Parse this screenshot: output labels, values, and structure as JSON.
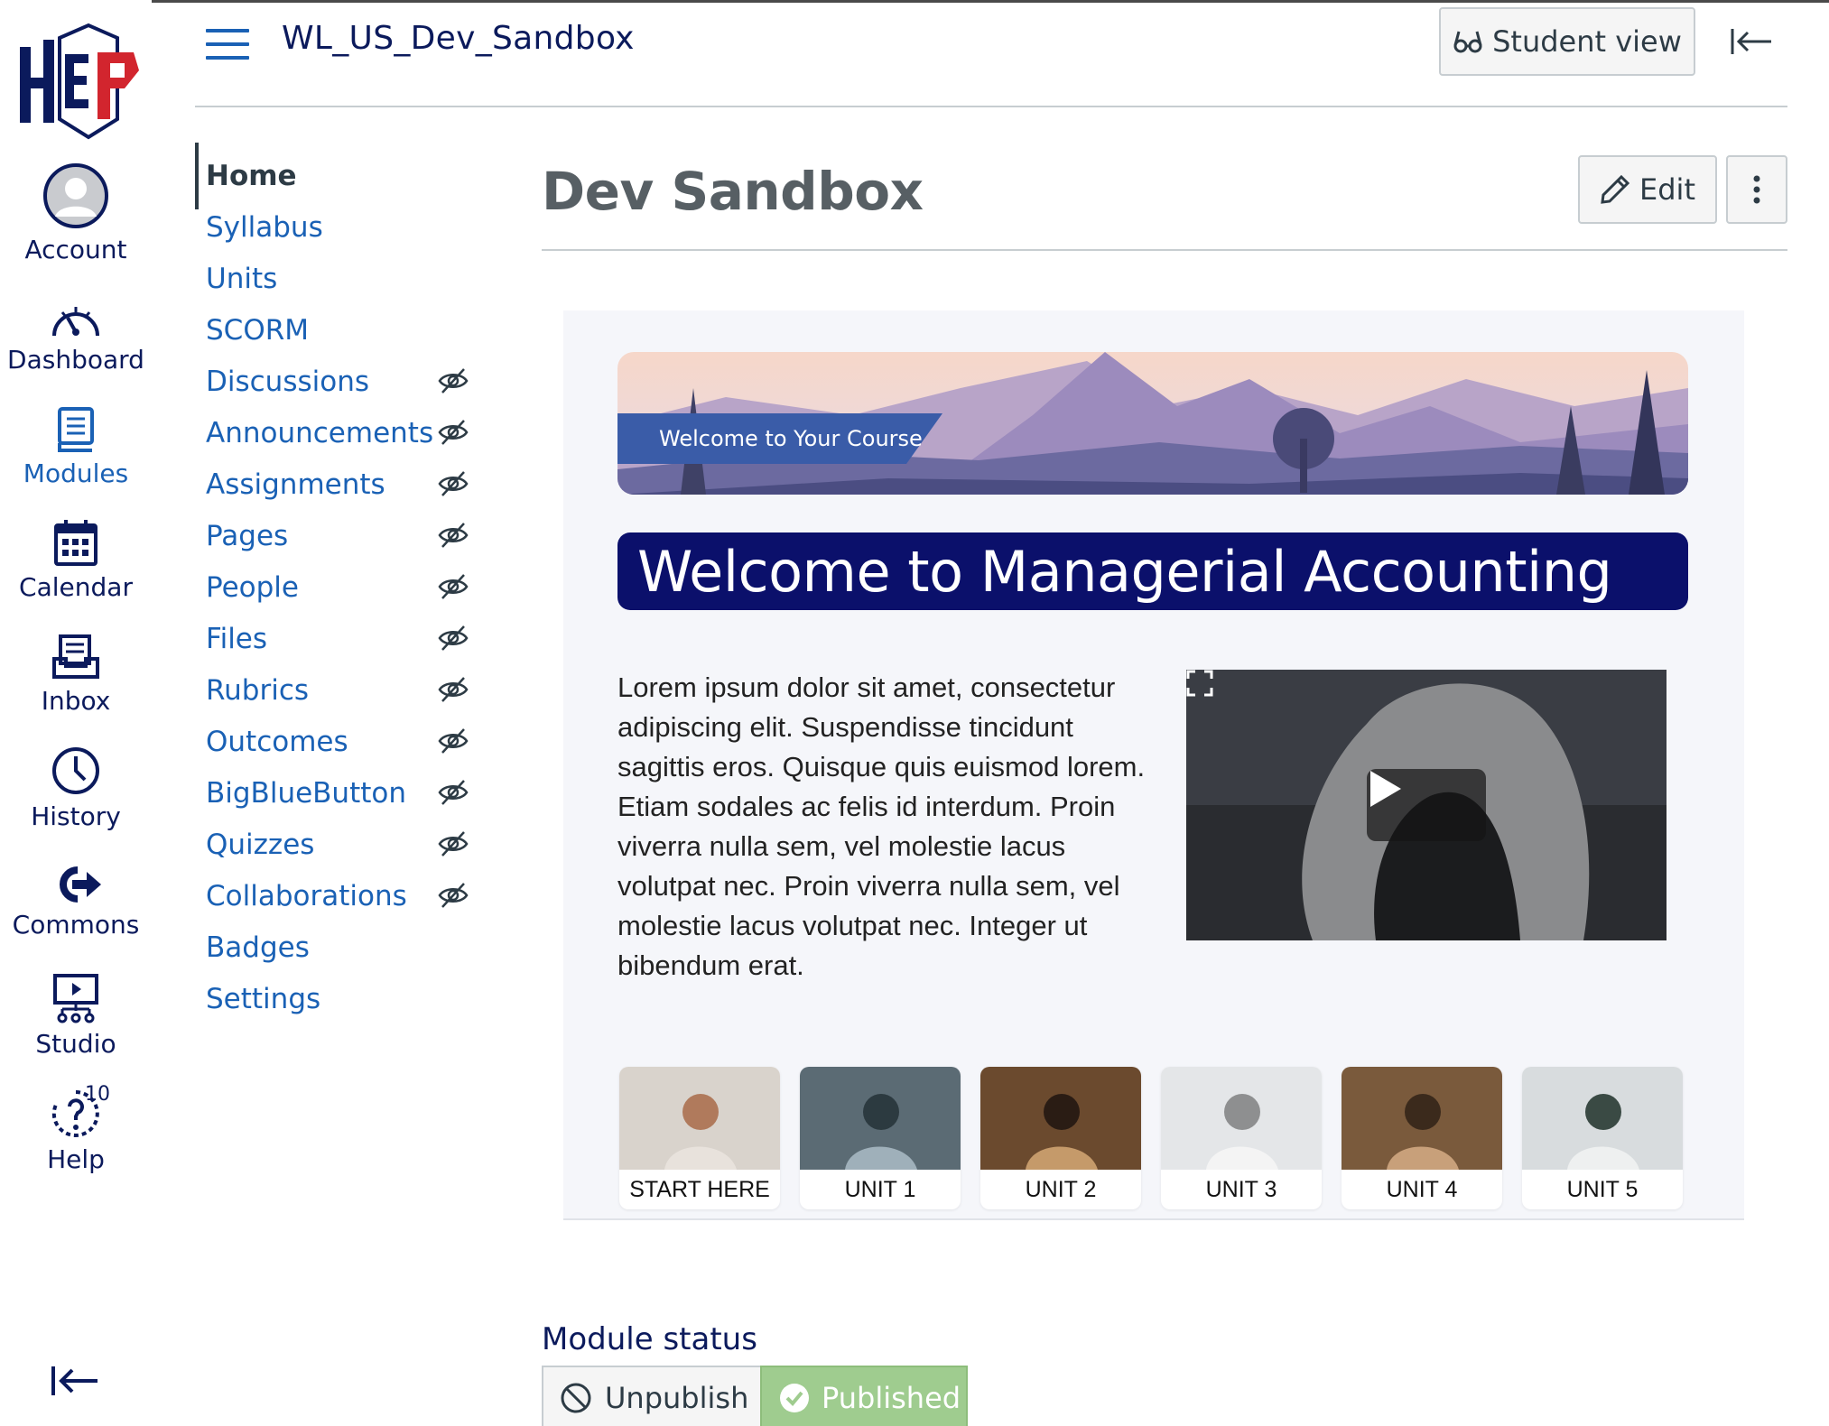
{
  "colors": {
    "accent": "#1a61b5",
    "navy": "#0b1a5c",
    "welcome_bar": "#0b106b",
    "published": "#9fcc8f"
  },
  "global_nav": {
    "logo_text": "HEP",
    "items": [
      {
        "label": "Account",
        "icon": "avatar-icon"
      },
      {
        "label": "Dashboard",
        "icon": "dashboard-icon"
      },
      {
        "label": "Modules",
        "icon": "modules-icon"
      },
      {
        "label": "Calendar",
        "icon": "calendar-icon"
      },
      {
        "label": "Inbox",
        "icon": "inbox-icon"
      },
      {
        "label": "History",
        "icon": "clock-icon"
      },
      {
        "label": "Commons",
        "icon": "commons-icon"
      },
      {
        "label": "Studio",
        "icon": "studio-icon"
      },
      {
        "label": "Help",
        "icon": "help-icon",
        "badge": "10"
      }
    ]
  },
  "header": {
    "course_name": "WL_US_Dev_Sandbox",
    "student_view_label": "Student view"
  },
  "course_nav": [
    {
      "label": "Home",
      "hidden": false
    },
    {
      "label": "Syllabus",
      "hidden": false
    },
    {
      "label": "Units",
      "hidden": false
    },
    {
      "label": "SCORM",
      "hidden": false
    },
    {
      "label": "Discussions",
      "hidden": true
    },
    {
      "label": "Announcements",
      "hidden": true
    },
    {
      "label": "Assignments",
      "hidden": true
    },
    {
      "label": "Pages",
      "hidden": true
    },
    {
      "label": "People",
      "hidden": true
    },
    {
      "label": "Files",
      "hidden": true
    },
    {
      "label": "Rubrics",
      "hidden": true
    },
    {
      "label": "Outcomes",
      "hidden": true
    },
    {
      "label": "BigBlueButton",
      "hidden": true
    },
    {
      "label": "Quizzes",
      "hidden": true
    },
    {
      "label": "Collaborations",
      "hidden": true
    },
    {
      "label": "Badges",
      "hidden": false
    },
    {
      "label": "Settings",
      "hidden": false
    }
  ],
  "main": {
    "title": "Dev Sandbox",
    "edit_label": "Edit",
    "banner_label": "Welcome to Your Course",
    "welcome_heading": "Welcome to Managerial Accounting",
    "body_text": "Lorem ipsum dolor sit amet, consectetur adipiscing elit. Suspendisse tincidunt sagittis eros. Quisque quis euismod lorem. Etiam sodales ac felis id interdum. Proin viverra nulla sem, vel molestie lacus volutpat nec. Proin viverra nulla sem, vel molestie lacus volutpat nec. Integer ut bibendum erat.",
    "units": [
      {
        "label": "START HERE"
      },
      {
        "label": "UNIT 1"
      },
      {
        "label": "UNIT 2"
      },
      {
        "label": "UNIT 3"
      },
      {
        "label": "UNIT 4"
      },
      {
        "label": "UNIT 5"
      }
    ]
  },
  "module_status": {
    "label": "Module status",
    "unpublish_label": "Unpublish",
    "published_label": "Published"
  }
}
